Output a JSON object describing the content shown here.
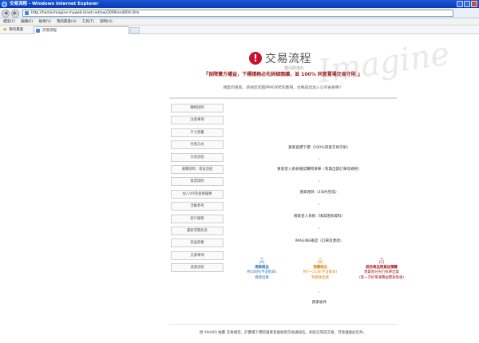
{
  "window": {
    "title": "交易流程 - Windows Internet Explorer"
  },
  "address": {
    "url": "http://haminimagine.myweb.hinet.net/aw/2009/and004.htm"
  },
  "menu": [
    "檔案(F)",
    "編輯(E)",
    "檢視(V)",
    "我的最愛(A)",
    "工具(T)",
    "說明(H)"
  ],
  "favorites": {
    "label": "我的最愛"
  },
  "tab": {
    "label": "交易流程"
  },
  "logo": {
    "title": "交易流程",
    "subtitle": "需引的流れ",
    "watermark": "Imagine"
  },
  "headline": "『保障雙方權益，下標請務必先詳細閱讀，並 100% 同意賣場交易守則 』",
  "subline": "親愛的買家，感謝您蒞臨IMAGINE的賣場，台鮮誠您加入公司會員嗎？",
  "sidebar": [
    "購物說明",
    "注意事項",
    "尺寸測量",
    "付款方式",
    "交易流程",
    "運費說明．寄送流程",
    "發票說明",
    "加入VIP及會員優惠",
    "活動參考",
    "客戶服務",
    "最新得獎訊息",
    "商品保養",
    "交貨事項",
    "退貨流程"
  ],
  "flow": {
    "steps": [
      "買家直標下標（100％同意交易守則）",
      "買家登入系統確認購物清單（有無出貨訂單及規格）",
      "買家匯款（3日內完成）",
      "買家登入系統（填寫匯款資料）",
      "IMAGINE確認（訂單及匯款）"
    ],
    "options": [
      {
        "code": "[A]",
        "name": "現貨商品",
        "line1": "約1日內(不含假日)",
        "line2": "直接出貨"
      },
      {
        "code": "[B]",
        "name": "預購商品",
        "line1": "約7～21日(不含假日)",
        "line2": "到貨後出貨"
      },
      {
        "code": "[C]",
        "name": "綜合商品現貨加預購",
        "line1": "現貨部分先行拆單出貨",
        "line2": "(第一次拆單運費由賣家吸收)"
      }
    ],
    "final": "買家收件"
  },
  "footer": "因 YAHOO 拍賣 交易規定，於賣場下標的買家皆會收到交易通知信，如您已完成交易，可免理會此信件。",
  "colors": {
    "accent": "#c8102e",
    "optA": "#1f6fae",
    "optB": "#d4860b",
    "optC": "#a11616"
  }
}
